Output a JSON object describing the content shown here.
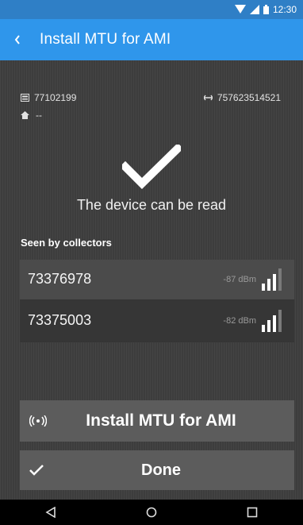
{
  "status_bar": {
    "time": "12:30"
  },
  "app_bar": {
    "title": "Install MTU for AMI"
  },
  "device": {
    "mtu_id": "77102199",
    "meter_id": "757623514521",
    "address": "--"
  },
  "result": {
    "message": "The device can be read"
  },
  "collectors": {
    "label": "Seen by collectors",
    "items": [
      {
        "id": "73376978",
        "signal": "-87 dBm",
        "bars": 3
      },
      {
        "id": "73375003",
        "signal": "-82 dBm",
        "bars": 3
      }
    ]
  },
  "actions": {
    "install_label": "Install MTU for AMI",
    "done_label": "Done"
  },
  "colors": {
    "status_bar": "#2f7fc6",
    "app_bar": "#2f96eb",
    "background": "#3d3d3d",
    "button": "#5c5c5c"
  }
}
